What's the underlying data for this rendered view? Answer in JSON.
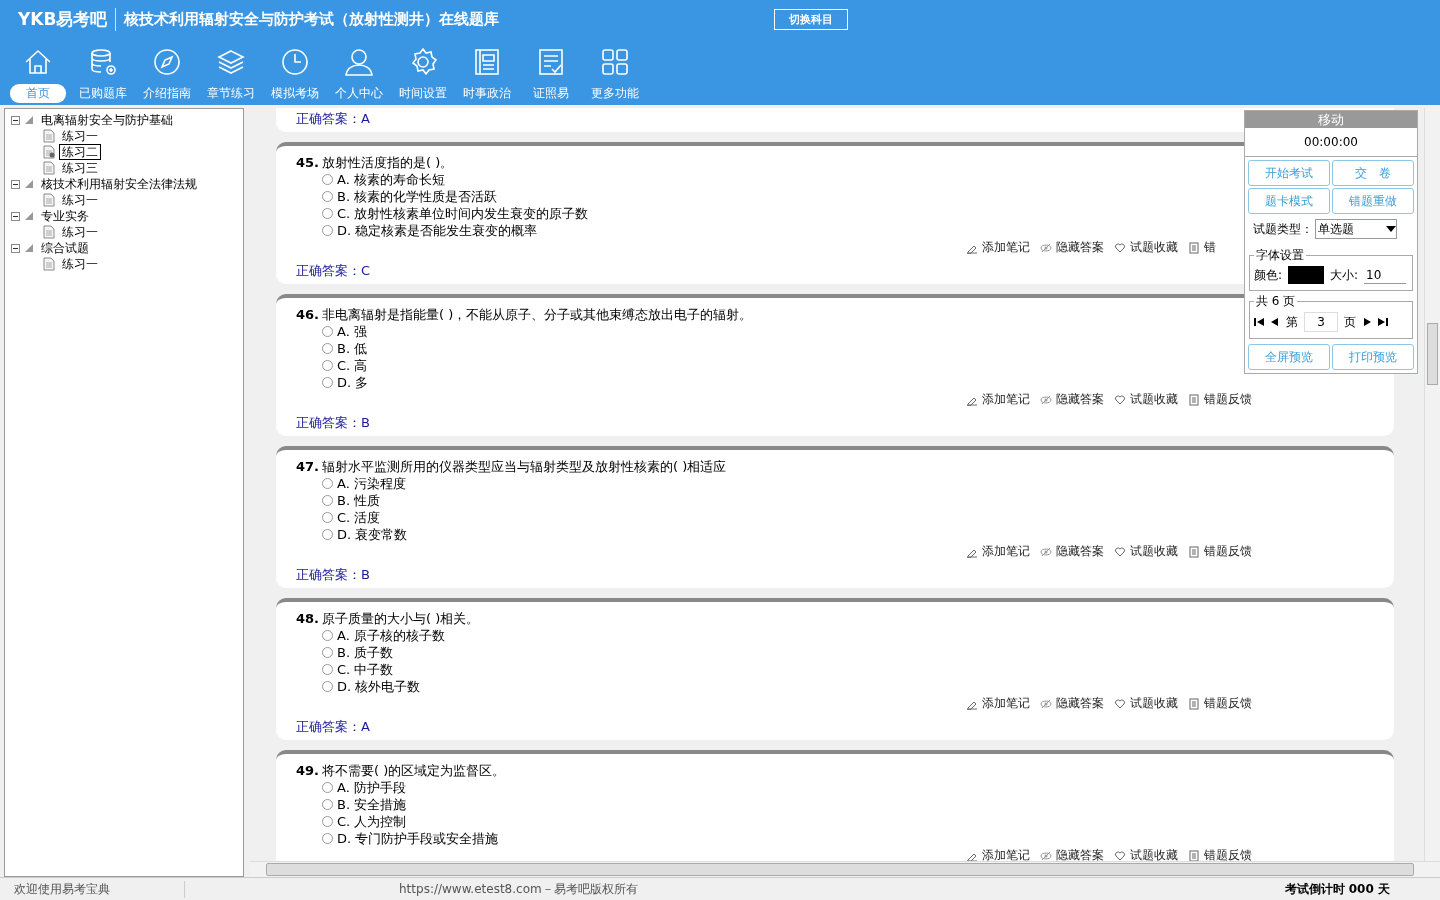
{
  "header": {
    "logo": "YKB易考吧",
    "title": "核技术利用辐射安全与防护考试（放射性测井）在线题库",
    "switch_button": "切换科目"
  },
  "nav": [
    {
      "label": "首页",
      "selected": true
    },
    {
      "label": "已购题库",
      "selected": false
    },
    {
      "label": "介绍指南",
      "selected": false
    },
    {
      "label": "章节练习",
      "selected": false
    },
    {
      "label": "模拟考场",
      "selected": false
    },
    {
      "label": "个人中心",
      "selected": false
    },
    {
      "label": "时间设置",
      "selected": false
    },
    {
      "label": "时事政治",
      "selected": false
    },
    {
      "label": "证照易",
      "selected": false
    },
    {
      "label": "更多功能",
      "selected": false
    }
  ],
  "tree": [
    {
      "label": "电离辐射安全与防护基础",
      "expanded": true,
      "selected": false,
      "children": [
        {
          "label": "练习一",
          "selected": false
        },
        {
          "label": "练习二",
          "selected": true
        },
        {
          "label": "练习三",
          "selected": false
        }
      ]
    },
    {
      "label": "核技术利用辐射安全法律法规",
      "expanded": true,
      "selected": false,
      "children": [
        {
          "label": "练习一",
          "selected": false
        }
      ]
    },
    {
      "label": "专业实务",
      "expanded": true,
      "selected": false,
      "children": [
        {
          "label": "练习一",
          "selected": false
        }
      ]
    },
    {
      "label": "综合试题",
      "expanded": true,
      "selected": false,
      "children": [
        {
          "label": "练习一",
          "selected": false
        }
      ]
    }
  ],
  "questions": [
    {
      "answer": "正确答案：A"
    },
    {
      "number": "45.",
      "text": "放射性活度指的是( )。",
      "options": [
        {
          "label": "A. 核素的寿命长短",
          "selected": false
        },
        {
          "label": "B. 核素的化学性质是否活跃",
          "selected": false
        },
        {
          "label": "C. 放射性核素单位时间内发生衰变的原子数",
          "selected": false
        },
        {
          "label": "D. 稳定核素是否能发生衰变的概率",
          "selected": false
        }
      ],
      "actions": [
        {
          "kind": "note",
          "label": "添加笔记"
        },
        {
          "kind": "hide",
          "label": "隐藏答案"
        },
        {
          "kind": "fav",
          "label": "试题收藏"
        },
        {
          "kind": "report",
          "label": "错"
        }
      ],
      "answer": "正确答案：C"
    },
    {
      "number": "46.",
      "text": "非电离辐射是指能量( )，不能从原子、分子或其他束缚态放出电子的辐射。",
      "options": [
        {
          "label": "A. 强",
          "selected": false
        },
        {
          "label": "B. 低",
          "selected": false
        },
        {
          "label": "C. 高",
          "selected": false
        },
        {
          "label": "D. 多",
          "selected": false
        }
      ],
      "actions": [
        {
          "kind": "note",
          "label": "添加笔记"
        },
        {
          "kind": "hide",
          "label": "隐藏答案"
        },
        {
          "kind": "fav",
          "label": "试题收藏"
        },
        {
          "kind": "report",
          "label": "错题反馈"
        }
      ],
      "answer": "正确答案：B"
    },
    {
      "number": "47.",
      "text": "辐射水平监测所用的仪器类型应当与辐射类型及放射性核素的( )相适应",
      "options": [
        {
          "label": "A. 污染程度",
          "selected": false
        },
        {
          "label": "B. 性质",
          "selected": false
        },
        {
          "label": "C. 活度",
          "selected": false
        },
        {
          "label": "D. 衰变常数",
          "selected": false
        }
      ],
      "actions": [
        {
          "kind": "note",
          "label": "添加笔记"
        },
        {
          "kind": "hide",
          "label": "隐藏答案"
        },
        {
          "kind": "fav",
          "label": "试题收藏"
        },
        {
          "kind": "report",
          "label": "错题反馈"
        }
      ],
      "answer": "正确答案：B"
    },
    {
      "number": "48.",
      "text": "原子质量的大小与( )相关。",
      "options": [
        {
          "label": "A. 原子核的核子数",
          "selected": false
        },
        {
          "label": "B. 质子数",
          "selected": false
        },
        {
          "label": "C. 中子数",
          "selected": false
        },
        {
          "label": "D. 核外电子数",
          "selected": false
        }
      ],
      "actions": [
        {
          "kind": "note",
          "label": "添加笔记"
        },
        {
          "kind": "hide",
          "label": "隐藏答案"
        },
        {
          "kind": "fav",
          "label": "试题收藏"
        },
        {
          "kind": "report",
          "label": "错题反馈"
        }
      ],
      "answer": "正确答案：A"
    },
    {
      "number": "49.",
      "text": "将不需要( )的区域定为监督区。",
      "options": [
        {
          "label": "A. 防护手段",
          "selected": false
        },
        {
          "label": "B. 安全措施",
          "selected": false
        },
        {
          "label": "C. 人为控制",
          "selected": false
        },
        {
          "label": "D. 专门防护手段或安全措施",
          "selected": false
        }
      ],
      "actions": [
        {
          "kind": "note",
          "label": "添加笔记"
        },
        {
          "kind": "hide",
          "label": "隐藏答案"
        },
        {
          "kind": "fav",
          "label": "试题收藏"
        },
        {
          "kind": "report",
          "label": "错题反馈"
        }
      ]
    }
  ],
  "panel": {
    "title": "移动",
    "timer": "00:00:00",
    "buttons": [
      "开始考试",
      "交　卷",
      "题卡模式",
      "错题重做"
    ],
    "type_label": "试题类型：",
    "type_value": "单选题",
    "font_legend": "字体设置",
    "color_label": "颜色:",
    "size_label": "大小:",
    "size_value": "10",
    "pages_legend": "共 6 页",
    "page_prefix": "第",
    "page_value": "3",
    "page_suffix": "页",
    "bottom_buttons": [
      "全屏预览",
      "打印预览"
    ]
  },
  "status_bar": {
    "welcome": "欢迎使用易考宝典",
    "copyright": "https://www.etest8.com－易考吧版权所有",
    "countdown": "考试倒计时 000 天"
  }
}
